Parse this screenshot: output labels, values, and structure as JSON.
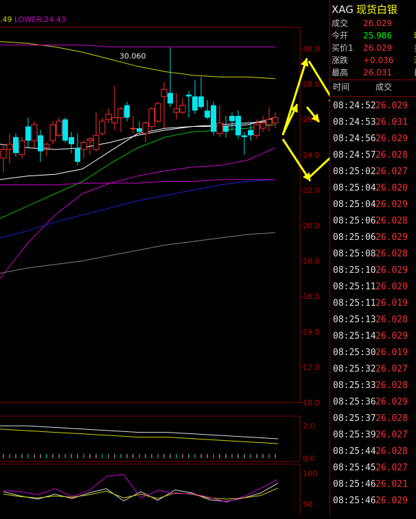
{
  "legend": {
    "mid_text": ".49",
    "lower_text": "LOWER:24.43"
  },
  "colors": {
    "up": "#ff3030",
    "down": "#00e5ee",
    "upper_band": "#d4d400",
    "lower_band": "#d000d0",
    "ma_white": "#ffffff",
    "ma_green": "#00c000",
    "ma_blue": "#2020e0",
    "ma_gray": "#808080",
    "grid": "#8b0000",
    "axis_text": "#c00000",
    "arrows": "#ffff00"
  },
  "chart_data": [
    {
      "type": "candlestick",
      "title": "",
      "annotation": "30.060",
      "y_ticks": [
        "30.0",
        "28.0",
        "26.0",
        "24.0",
        "22.0",
        "20.0",
        "18.0",
        "16.0",
        "14.0",
        "12.0",
        "10.0"
      ],
      "ylim": [
        10.0,
        31.2
      ],
      "candles": [
        {
          "o": 23.8,
          "h": 24.6,
          "l": 23.0,
          "c": 24.3
        },
        {
          "o": 24.3,
          "h": 25.2,
          "l": 23.5,
          "c": 24.6
        },
        {
          "o": 25.0,
          "h": 25.2,
          "l": 23.9,
          "c": 24.1
        },
        {
          "o": 24.0,
          "h": 25.0,
          "l": 23.8,
          "c": 24.8
        },
        {
          "o": 25.6,
          "h": 26.1,
          "l": 24.4,
          "c": 24.8
        },
        {
          "o": 24.8,
          "h": 25.9,
          "l": 24.4,
          "c": 25.7
        },
        {
          "o": 25.1,
          "h": 25.4,
          "l": 23.6,
          "c": 24.2
        },
        {
          "o": 24.4,
          "h": 24.7,
          "l": 23.9,
          "c": 24.6
        },
        {
          "o": 24.8,
          "h": 25.9,
          "l": 24.6,
          "c": 25.7
        },
        {
          "o": 25.1,
          "h": 26.1,
          "l": 25.0,
          "c": 25.9
        },
        {
          "o": 26.0,
          "h": 26.1,
          "l": 24.7,
          "c": 24.8
        },
        {
          "o": 25.0,
          "h": 25.3,
          "l": 24.1,
          "c": 24.6
        },
        {
          "o": 24.4,
          "h": 25.2,
          "l": 23.4,
          "c": 23.6
        },
        {
          "o": 24.3,
          "h": 24.8,
          "l": 23.8,
          "c": 24.7
        },
        {
          "o": 24.8,
          "h": 25.0,
          "l": 24.0,
          "c": 24.9
        },
        {
          "o": 24.3,
          "h": 26.4,
          "l": 24.2,
          "c": 25.1
        },
        {
          "o": 25.2,
          "h": 26.1,
          "l": 25.1,
          "c": 25.9
        },
        {
          "o": 26.0,
          "h": 26.6,
          "l": 25.8,
          "c": 26.3
        },
        {
          "o": 25.8,
          "h": 27.9,
          "l": 25.4,
          "c": 26.1
        },
        {
          "o": 26.1,
          "h": 26.7,
          "l": 25.3,
          "c": 26.6
        },
        {
          "o": 26.8,
          "h": 27.0,
          "l": 25.9,
          "c": 26.1
        },
        {
          "o": 25.5,
          "h": 26.2,
          "l": 25.2,
          "c": 25.5
        },
        {
          "o": 25.5,
          "h": 25.9,
          "l": 25.2,
          "c": 25.3
        },
        {
          "o": 25.2,
          "h": 25.9,
          "l": 24.7,
          "c": 25.8
        },
        {
          "o": 25.6,
          "h": 26.7,
          "l": 25.4,
          "c": 26.6
        },
        {
          "o": 25.9,
          "h": 27.0,
          "l": 25.8,
          "c": 26.9
        },
        {
          "o": 27.3,
          "h": 28.1,
          "l": 25.5,
          "c": 27.7
        },
        {
          "o": 27.5,
          "h": 30.06,
          "l": 26.7,
          "c": 26.9
        },
        {
          "o": 26.4,
          "h": 27.5,
          "l": 26.0,
          "c": 26.6
        },
        {
          "o": 26.4,
          "h": 27.2,
          "l": 26.3,
          "c": 26.8
        },
        {
          "o": 27.4,
          "h": 27.6,
          "l": 26.1,
          "c": 27.3
        },
        {
          "o": 27.3,
          "h": 28.2,
          "l": 26.3,
          "c": 26.5
        },
        {
          "o": 27.3,
          "h": 28.4,
          "l": 26.6,
          "c": 26.7
        },
        {
          "o": 26.5,
          "h": 27.1,
          "l": 26.0,
          "c": 26.1
        },
        {
          "o": 26.8,
          "h": 27.0,
          "l": 25.1,
          "c": 25.3
        },
        {
          "o": 25.2,
          "h": 26.8,
          "l": 25.0,
          "c": 25.8
        },
        {
          "o": 25.6,
          "h": 26.2,
          "l": 25.0,
          "c": 25.3
        },
        {
          "o": 26.2,
          "h": 26.4,
          "l": 25.4,
          "c": 25.9
        },
        {
          "o": 26.2,
          "h": 26.5,
          "l": 24.9,
          "c": 25.1
        },
        {
          "o": 25.1,
          "h": 25.3,
          "l": 24.0,
          "c": 25.0
        },
        {
          "o": 25.4,
          "h": 25.8,
          "l": 24.8,
          "c": 25.1
        },
        {
          "o": 25.1,
          "h": 26.0,
          "l": 24.9,
          "c": 25.7
        },
        {
          "o": 25.5,
          "h": 26.2,
          "l": 25.3,
          "c": 25.8
        },
        {
          "o": 25.7,
          "h": 26.7,
          "l": 25.3,
          "c": 26.0
        },
        {
          "o": 25.8,
          "h": 26.4,
          "l": 25.5,
          "c": 26.1
        }
      ],
      "series": [
        {
          "values": [
            30.4,
            30.3,
            30.1,
            29.8,
            29.4,
            29.0,
            28.7,
            28.5,
            28.4,
            28.4,
            28.3
          ]
        },
        {
          "values": [
            24.6,
            24.4,
            24.3,
            24.4,
            24.7,
            25.1,
            25.4,
            25.6,
            25.7,
            25.8,
            25.9
          ]
        },
        {
          "values": [
            17.0,
            19.0,
            20.6,
            21.8,
            22.4,
            22.8,
            23.1,
            23.3,
            23.4,
            23.7,
            24.4
          ]
        },
        {
          "values": [
            22.6,
            22.8,
            22.9,
            23.2,
            24.2,
            25.2,
            25.5,
            25.6,
            25.6,
            25.7,
            26.1
          ]
        },
        {
          "values": [
            20.4,
            21.1,
            21.8,
            22.5,
            23.5,
            24.4,
            25.0,
            25.3,
            25.4,
            25.5,
            25.7
          ]
        },
        {
          "values": [
            19.3,
            19.7,
            20.2,
            20.6,
            21.0,
            21.4,
            21.7,
            22.0,
            22.3,
            22.5,
            22.6
          ]
        },
        {
          "values": [
            17.3,
            17.6,
            17.8,
            18.0,
            18.3,
            18.6,
            18.9,
            19.1,
            19.3,
            19.5,
            19.6
          ]
        },
        {
          "values": [
            22.3,
            22.3,
            22.3,
            22.4,
            22.4,
            22.4,
            22.5,
            22.5,
            22.6,
            22.6,
            22.6
          ]
        },
        {
          "values": [
            30.2,
            30.2,
            30.2,
            30.2,
            30.1,
            30.1,
            30.1,
            30.1,
            30.1,
            30.1,
            30.1
          ]
        }
      ]
    },
    {
      "type": "line",
      "y_ticks": [
        "2.0",
        "0.0"
      ],
      "ylim": [
        -0.2,
        2.6
      ],
      "series": [
        {
          "values": [
            2.0,
            2.0,
            1.9,
            1.8,
            1.7,
            1.6,
            1.6,
            1.5,
            1.4,
            1.3,
            1.2
          ]
        },
        {
          "values": [
            1.8,
            1.7,
            1.6,
            1.5,
            1.4,
            1.3,
            1.3,
            1.2,
            1.1,
            1.0,
            0.9
          ]
        }
      ]
    },
    {
      "type": "line",
      "y_ticks": [
        "100",
        "50"
      ],
      "ylim": [
        30,
        115
      ],
      "series": [
        {
          "values": [
            70,
            63,
            58,
            66,
            59,
            68,
            75,
            55,
            70,
            56,
            73,
            68,
            57,
            54,
            60,
            68,
            84
          ]
        },
        {
          "values": [
            66,
            62,
            60,
            63,
            61,
            65,
            71,
            60,
            66,
            59,
            68,
            66,
            60,
            58,
            60,
            64,
            76
          ]
        },
        {
          "values": [
            72,
            70,
            65,
            75,
            62,
            72,
            95,
            98,
            60,
            72,
            67,
            67,
            61,
            53,
            62,
            76,
            90
          ]
        }
      ]
    }
  ],
  "panel": {
    "code": "XAG",
    "name": "现货白银",
    "quotes": [
      {
        "label": "成交",
        "value": "26.029",
        "color": "#ff3030",
        "extra": ""
      },
      {
        "label": "今开",
        "value": "25.986",
        "color": "#00ff00",
        "extra": "昨"
      },
      {
        "label": "买价1",
        "value": "26.029",
        "color": "#ff3030",
        "extra": "卖"
      },
      {
        "label": "涨跌",
        "value": "+0.036",
        "color": "#ff3030",
        "extra": "涨"
      },
      {
        "label": "最高",
        "value": "26.031",
        "color": "#ff3030",
        "extra": "最"
      }
    ],
    "ticks_header": {
      "time": "时间",
      "price": "成交"
    },
    "ticks": [
      {
        "time": "08:24:52",
        "price": "26.029"
      },
      {
        "time": "08:24:53",
        "price": "26.031"
      },
      {
        "time": "08:24:56",
        "price": "26.029"
      },
      {
        "time": "08:24:57",
        "price": "26.028"
      },
      {
        "time": "08:25:02",
        "price": "26.027"
      },
      {
        "time": "08:25:04",
        "price": "26.020"
      },
      {
        "time": "08:25:04",
        "price": "26.029"
      },
      {
        "time": "08:25:06",
        "price": "26.028"
      },
      {
        "time": "08:25:06",
        "price": "26.029"
      },
      {
        "time": "08:25:08",
        "price": "26.028"
      },
      {
        "time": "08:25:10",
        "price": "26.029"
      },
      {
        "time": "08:25:11",
        "price": "26.020"
      },
      {
        "time": "08:25:11",
        "price": "26.019"
      },
      {
        "time": "08:25:13",
        "price": "26.028"
      },
      {
        "time": "08:25:14",
        "price": "26.029"
      },
      {
        "time": "08:25:30",
        "price": "26.019"
      },
      {
        "time": "08:25:32",
        "price": "26.027"
      },
      {
        "time": "08:25:33",
        "price": "26.028"
      },
      {
        "time": "08:25:36",
        "price": "26.029"
      },
      {
        "time": "08:25:37",
        "price": "26.028"
      },
      {
        "time": "08:25:39",
        "price": "26.027"
      },
      {
        "time": "08:25:44",
        "price": "26.028"
      },
      {
        "time": "08:25:45",
        "price": "26.027"
      },
      {
        "time": "08:25:46",
        "price": "26.021"
      },
      {
        "time": "08:25:46",
        "price": "26.029"
      }
    ]
  }
}
